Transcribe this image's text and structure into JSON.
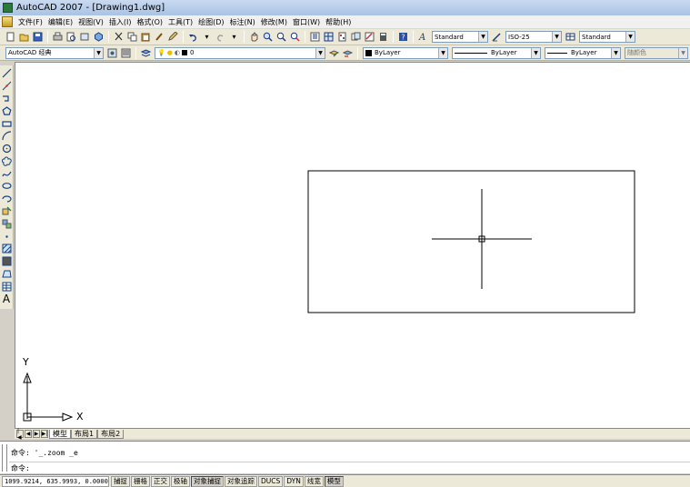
{
  "window": {
    "title": "AutoCAD 2007 - [Drawing1.dwg]"
  },
  "menu": [
    "文件(F)",
    "编辑(E)",
    "视图(V)",
    "插入(I)",
    "格式(O)",
    "工具(T)",
    "绘图(D)",
    "标注(N)",
    "修改(M)",
    "窗口(W)",
    "帮助(H)"
  ],
  "toolbar1": {
    "text_style": "Standard",
    "dim_style": "ISO-25",
    "table_style": "Standard"
  },
  "toolbar2": {
    "workspace": "AutoCAD 经典",
    "layer": "0",
    "color": "ByLayer",
    "linetype": "ByLayer",
    "lineweight": "ByLayer",
    "plot_style": "随颜色"
  },
  "canvas": {
    "ucs_y_label": "Y",
    "ucs_x_label": "X"
  },
  "layout_tabs": [
    {
      "label": "模型",
      "active": true
    },
    {
      "label": "布局1",
      "active": false
    },
    {
      "label": "布局2",
      "active": false
    }
  ],
  "command": {
    "history": "命令: '_.zoom _e",
    "prompt": "命令:"
  },
  "status": {
    "coordinates": "1099.9214, 635.9993, 0.0000",
    "toggles": [
      {
        "label": "捕捉",
        "on": false
      },
      {
        "label": "栅格",
        "on": false
      },
      {
        "label": "正交",
        "on": false
      },
      {
        "label": "极轴",
        "on": false
      },
      {
        "label": "对象捕捉",
        "on": true
      },
      {
        "label": "对象追踪",
        "on": false
      },
      {
        "label": "DUCS",
        "on": false
      },
      {
        "label": "DYN",
        "on": false
      },
      {
        "label": "线宽",
        "on": false
      },
      {
        "label": "模型",
        "on": true
      }
    ]
  },
  "colors": {
    "canvas_bg": "#ffffff",
    "chrome": "#ece9d8",
    "title_gradient_top": "#c9daf1"
  }
}
